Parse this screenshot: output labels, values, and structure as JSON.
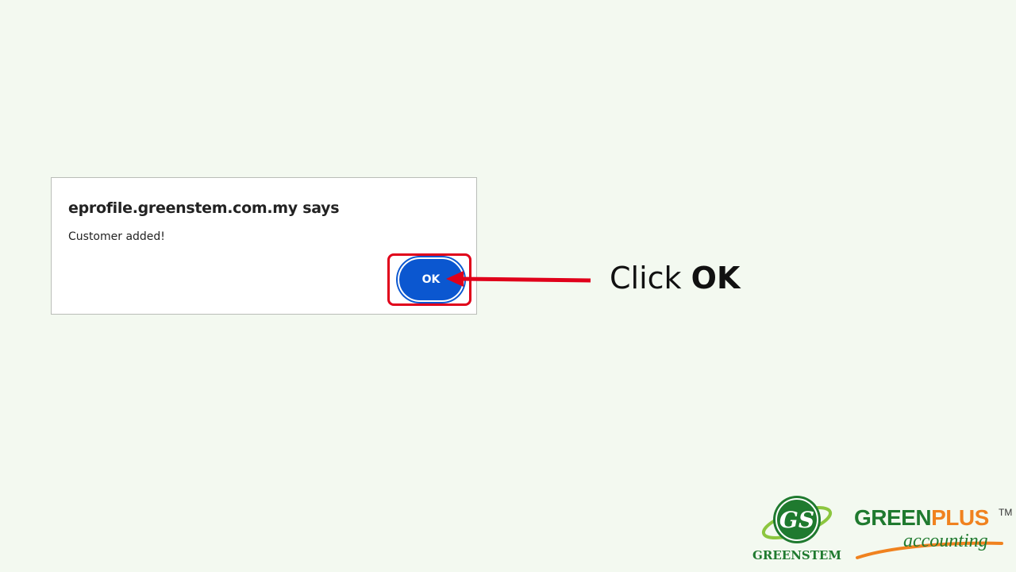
{
  "dialog": {
    "title": "eprofile.greenstem.com.my says",
    "message": "Customer added!",
    "ok_label": "OK"
  },
  "instruction": {
    "prefix": "Click ",
    "emphasis": "OK"
  },
  "logos": {
    "greenstem": {
      "word": "GREENSTEM",
      "monogram": "GS"
    },
    "greenplus": {
      "part1": "GREEN",
      "part2": "PLUS",
      "tm": "TM",
      "sub": "accounting"
    }
  },
  "colors": {
    "background": "#f3f9f0",
    "button": "#0b57d0",
    "highlight": "#e0001a",
    "brand_green": "#1f7a2f",
    "brand_orange": "#f0821f"
  }
}
